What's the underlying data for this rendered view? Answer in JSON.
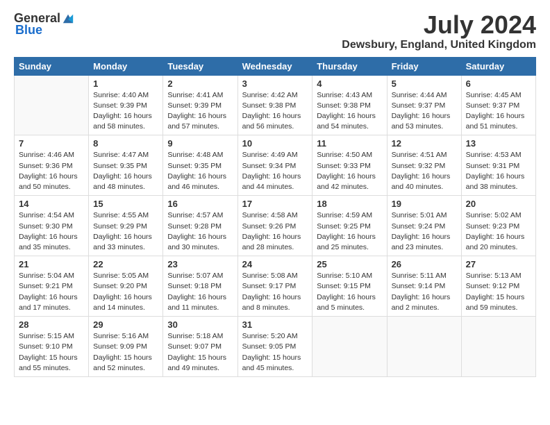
{
  "header": {
    "logo_general": "General",
    "logo_blue": "Blue",
    "month_year": "July 2024",
    "location": "Dewsbury, England, United Kingdom"
  },
  "days_of_week": [
    "Sunday",
    "Monday",
    "Tuesday",
    "Wednesday",
    "Thursday",
    "Friday",
    "Saturday"
  ],
  "weeks": [
    [
      {
        "day": "",
        "sunrise": "",
        "sunset": "",
        "daylight": ""
      },
      {
        "day": "1",
        "sunrise": "Sunrise: 4:40 AM",
        "sunset": "Sunset: 9:39 PM",
        "daylight": "Daylight: 16 hours and 58 minutes."
      },
      {
        "day": "2",
        "sunrise": "Sunrise: 4:41 AM",
        "sunset": "Sunset: 9:39 PM",
        "daylight": "Daylight: 16 hours and 57 minutes."
      },
      {
        "day": "3",
        "sunrise": "Sunrise: 4:42 AM",
        "sunset": "Sunset: 9:38 PM",
        "daylight": "Daylight: 16 hours and 56 minutes."
      },
      {
        "day": "4",
        "sunrise": "Sunrise: 4:43 AM",
        "sunset": "Sunset: 9:38 PM",
        "daylight": "Daylight: 16 hours and 54 minutes."
      },
      {
        "day": "5",
        "sunrise": "Sunrise: 4:44 AM",
        "sunset": "Sunset: 9:37 PM",
        "daylight": "Daylight: 16 hours and 53 minutes."
      },
      {
        "day": "6",
        "sunrise": "Sunrise: 4:45 AM",
        "sunset": "Sunset: 9:37 PM",
        "daylight": "Daylight: 16 hours and 51 minutes."
      }
    ],
    [
      {
        "day": "7",
        "sunrise": "Sunrise: 4:46 AM",
        "sunset": "Sunset: 9:36 PM",
        "daylight": "Daylight: 16 hours and 50 minutes."
      },
      {
        "day": "8",
        "sunrise": "Sunrise: 4:47 AM",
        "sunset": "Sunset: 9:35 PM",
        "daylight": "Daylight: 16 hours and 48 minutes."
      },
      {
        "day": "9",
        "sunrise": "Sunrise: 4:48 AM",
        "sunset": "Sunset: 9:35 PM",
        "daylight": "Daylight: 16 hours and 46 minutes."
      },
      {
        "day": "10",
        "sunrise": "Sunrise: 4:49 AM",
        "sunset": "Sunset: 9:34 PM",
        "daylight": "Daylight: 16 hours and 44 minutes."
      },
      {
        "day": "11",
        "sunrise": "Sunrise: 4:50 AM",
        "sunset": "Sunset: 9:33 PM",
        "daylight": "Daylight: 16 hours and 42 minutes."
      },
      {
        "day": "12",
        "sunrise": "Sunrise: 4:51 AM",
        "sunset": "Sunset: 9:32 PM",
        "daylight": "Daylight: 16 hours and 40 minutes."
      },
      {
        "day": "13",
        "sunrise": "Sunrise: 4:53 AM",
        "sunset": "Sunset: 9:31 PM",
        "daylight": "Daylight: 16 hours and 38 minutes."
      }
    ],
    [
      {
        "day": "14",
        "sunrise": "Sunrise: 4:54 AM",
        "sunset": "Sunset: 9:30 PM",
        "daylight": "Daylight: 16 hours and 35 minutes."
      },
      {
        "day": "15",
        "sunrise": "Sunrise: 4:55 AM",
        "sunset": "Sunset: 9:29 PM",
        "daylight": "Daylight: 16 hours and 33 minutes."
      },
      {
        "day": "16",
        "sunrise": "Sunrise: 4:57 AM",
        "sunset": "Sunset: 9:28 PM",
        "daylight": "Daylight: 16 hours and 30 minutes."
      },
      {
        "day": "17",
        "sunrise": "Sunrise: 4:58 AM",
        "sunset": "Sunset: 9:26 PM",
        "daylight": "Daylight: 16 hours and 28 minutes."
      },
      {
        "day": "18",
        "sunrise": "Sunrise: 4:59 AM",
        "sunset": "Sunset: 9:25 PM",
        "daylight": "Daylight: 16 hours and 25 minutes."
      },
      {
        "day": "19",
        "sunrise": "Sunrise: 5:01 AM",
        "sunset": "Sunset: 9:24 PM",
        "daylight": "Daylight: 16 hours and 23 minutes."
      },
      {
        "day": "20",
        "sunrise": "Sunrise: 5:02 AM",
        "sunset": "Sunset: 9:23 PM",
        "daylight": "Daylight: 16 hours and 20 minutes."
      }
    ],
    [
      {
        "day": "21",
        "sunrise": "Sunrise: 5:04 AM",
        "sunset": "Sunset: 9:21 PM",
        "daylight": "Daylight: 16 hours and 17 minutes."
      },
      {
        "day": "22",
        "sunrise": "Sunrise: 5:05 AM",
        "sunset": "Sunset: 9:20 PM",
        "daylight": "Daylight: 16 hours and 14 minutes."
      },
      {
        "day": "23",
        "sunrise": "Sunrise: 5:07 AM",
        "sunset": "Sunset: 9:18 PM",
        "daylight": "Daylight: 16 hours and 11 minutes."
      },
      {
        "day": "24",
        "sunrise": "Sunrise: 5:08 AM",
        "sunset": "Sunset: 9:17 PM",
        "daylight": "Daylight: 16 hours and 8 minutes."
      },
      {
        "day": "25",
        "sunrise": "Sunrise: 5:10 AM",
        "sunset": "Sunset: 9:15 PM",
        "daylight": "Daylight: 16 hours and 5 minutes."
      },
      {
        "day": "26",
        "sunrise": "Sunrise: 5:11 AM",
        "sunset": "Sunset: 9:14 PM",
        "daylight": "Daylight: 16 hours and 2 minutes."
      },
      {
        "day": "27",
        "sunrise": "Sunrise: 5:13 AM",
        "sunset": "Sunset: 9:12 PM",
        "daylight": "Daylight: 15 hours and 59 minutes."
      }
    ],
    [
      {
        "day": "28",
        "sunrise": "Sunrise: 5:15 AM",
        "sunset": "Sunset: 9:10 PM",
        "daylight": "Daylight: 15 hours and 55 minutes."
      },
      {
        "day": "29",
        "sunrise": "Sunrise: 5:16 AM",
        "sunset": "Sunset: 9:09 PM",
        "daylight": "Daylight: 15 hours and 52 minutes."
      },
      {
        "day": "30",
        "sunrise": "Sunrise: 5:18 AM",
        "sunset": "Sunset: 9:07 PM",
        "daylight": "Daylight: 15 hours and 49 minutes."
      },
      {
        "day": "31",
        "sunrise": "Sunrise: 5:20 AM",
        "sunset": "Sunset: 9:05 PM",
        "daylight": "Daylight: 15 hours and 45 minutes."
      },
      {
        "day": "",
        "sunrise": "",
        "sunset": "",
        "daylight": ""
      },
      {
        "day": "",
        "sunrise": "",
        "sunset": "",
        "daylight": ""
      },
      {
        "day": "",
        "sunrise": "",
        "sunset": "",
        "daylight": ""
      }
    ]
  ]
}
